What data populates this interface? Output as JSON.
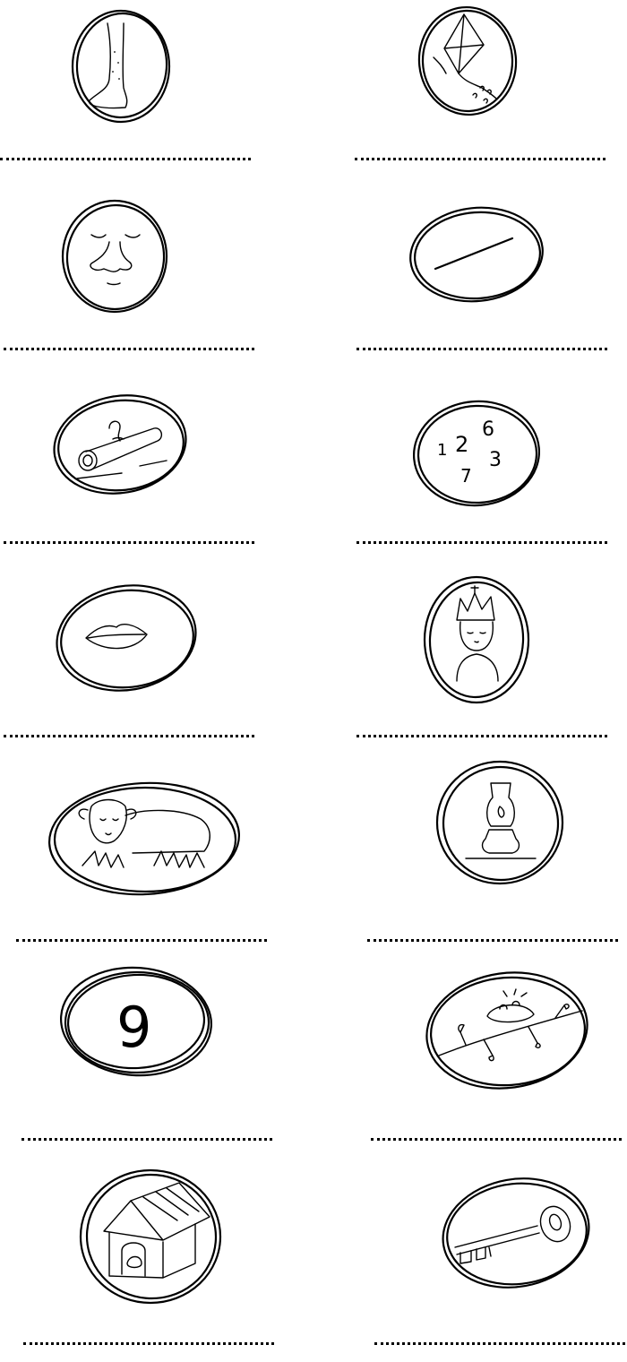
{
  "worksheet": {
    "items": [
      {
        "icon": "leg-icon"
      },
      {
        "icon": "kite-icon"
      },
      {
        "icon": "nose-face-icon"
      },
      {
        "icon": "line-dash-icon"
      },
      {
        "icon": "log-icon"
      },
      {
        "icon": "numbers-icon",
        "digits": [
          "1",
          "2",
          "6",
          "3",
          "7"
        ]
      },
      {
        "icon": "lips-icon"
      },
      {
        "icon": "king-icon"
      },
      {
        "icon": "lamb-icon"
      },
      {
        "icon": "lamp-icon"
      },
      {
        "icon": "nine-icon",
        "digit": "9"
      },
      {
        "icon": "nest-icon"
      },
      {
        "icon": "kennel-icon"
      },
      {
        "icon": "key-icon"
      }
    ]
  }
}
